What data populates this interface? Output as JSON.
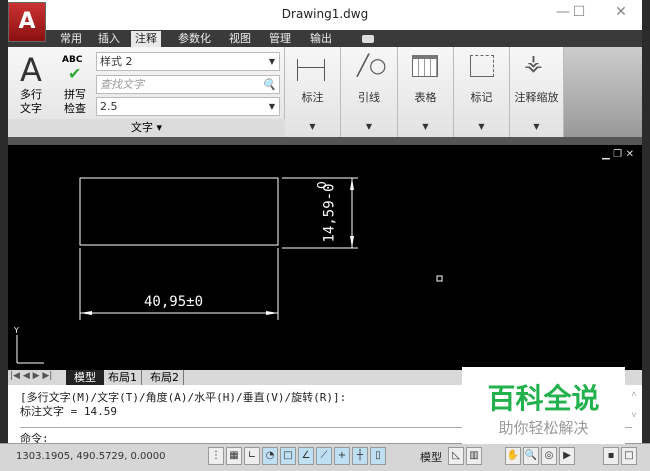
{
  "window": {
    "title": "Drawing1.dwg",
    "app_logo": "A"
  },
  "tabs": [
    "常用",
    "插入",
    "注释",
    "参数化",
    "视图",
    "管理",
    "输出"
  ],
  "active_tab": "注释",
  "ribbon": {
    "text_panel": {
      "mtext_label1": "多行",
      "mtext_label2": "文字",
      "spell_label1": "拼写",
      "spell_label2": "检查",
      "spell_abc": "ABC",
      "style_value": "样式 2",
      "find_placeholder": "查找文字",
      "height_value": "2.5",
      "panel_title": "文字 ▾"
    },
    "panels": [
      "标注",
      "引线",
      "表格",
      "标记",
      "注释缩放"
    ]
  },
  "drawing": {
    "horizontal_dim": "40,95±0",
    "vertical_dim": "14,59-0",
    "vertical_tol": "0"
  },
  "layout_tabs": [
    "模型",
    "布局1",
    "布局2"
  ],
  "command": {
    "line1": "[多行文字(M)/文字(T)/角度(A)/水平(H)/垂直(V)/旋转(R)]:",
    "line2": "标注文字 = 14.59",
    "prompt": "命令:"
  },
  "status": {
    "coords": "1303.1905, 490.5729, 0.0000",
    "model": "模型"
  },
  "watermark": {
    "title": "百科全说",
    "subtitle": "助你轻松解决",
    "color": "#22b14c"
  }
}
